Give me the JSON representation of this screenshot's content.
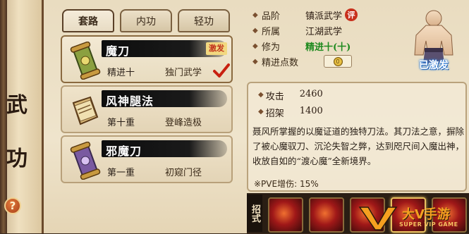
{
  "left_scroll": {
    "chars": [
      "武",
      "功"
    ],
    "help_label": "?"
  },
  "tabs": [
    {
      "label": "套路",
      "active": true
    },
    {
      "label": "内功",
      "active": false
    },
    {
      "label": "轻功",
      "active": false
    }
  ],
  "skills_list": [
    {
      "name": "魔刀",
      "level": "精进十",
      "stage": "独门武学",
      "tag": "激发",
      "icon": "scroll-icon",
      "selected": true,
      "checked": true
    },
    {
      "name": "风神腿法",
      "level": "第十重",
      "stage": "登峰造极",
      "tag": "",
      "icon": "book-icon",
      "selected": false,
      "checked": false
    },
    {
      "name": "邪魔刀",
      "level": "第一重",
      "stage": "初窥门径",
      "tag": "",
      "icon": "scroll-icon",
      "selected": false,
      "checked": false
    }
  ],
  "info": {
    "rank_label": "品阶",
    "rank_value": "镇派武学",
    "rank_badge": "评",
    "sect_label": "所属",
    "sect_value": "江湖武学",
    "cultivation_label": "修为",
    "cultivation_value": "精进十(十)",
    "points_label": "精进点数",
    "points_value": "0"
  },
  "avatar_status": "已激发",
  "detail": {
    "attack_label": "攻击",
    "attack_value": "2460",
    "parry_label": "招架",
    "parry_value": "1400",
    "description": "聂风所掌握的以魔证道的独特刀法。其刀法之意，摒除了被心魔驭刀、沉沦失智之弊，达到咫尺间入魔出神，收放自如的“渡心魔”全新境界。",
    "pve_bonus": "※PVE增伤: 15%"
  },
  "skills_bar": {
    "label": "招式",
    "count": 5
  },
  "watermark": {
    "big": "大V手游",
    "small": "SUPER VIP GAME"
  },
  "colors": {
    "accent_red": "#c8301c",
    "green": "#1f8a1f",
    "paper": "#efe4cc"
  }
}
